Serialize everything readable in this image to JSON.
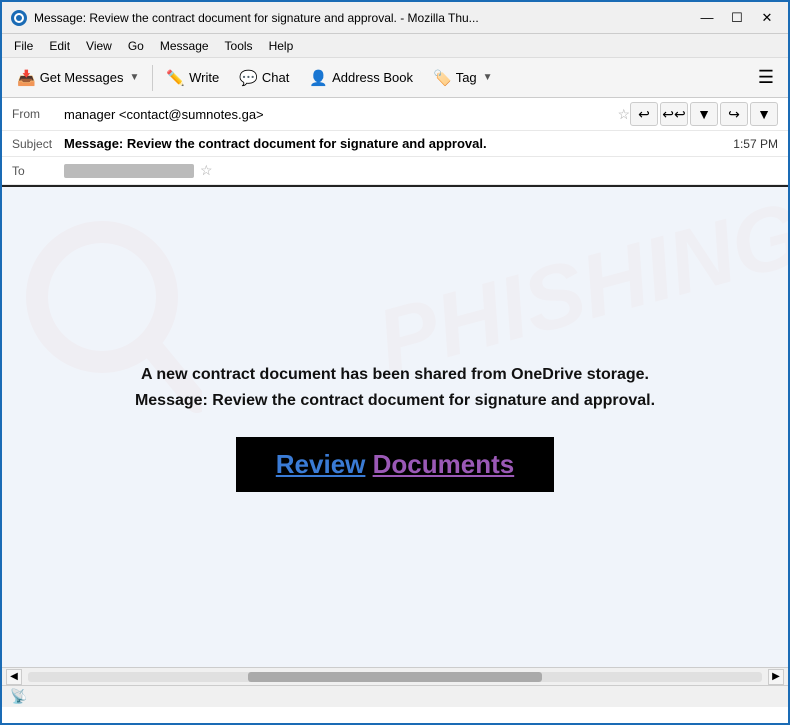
{
  "titlebar": {
    "icon": "🦣",
    "title": "Message: Review the contract document for signature and approval. - Mozilla Thu...",
    "minimize": "—",
    "maximize": "☐",
    "close": "✕"
  },
  "menubar": {
    "items": [
      "File",
      "Edit",
      "View",
      "Go",
      "Message",
      "Tools",
      "Help"
    ]
  },
  "toolbar": {
    "get_messages_label": "Get Messages",
    "write_label": "Write",
    "chat_label": "Chat",
    "address_book_label": "Address Book",
    "tag_label": "Tag"
  },
  "email": {
    "from_label": "From",
    "from_value": "manager <contact@sumnotes.ga>",
    "subject_label": "Subject",
    "subject_value": "Message: Review the contract document for signature and approval.",
    "time": "1:57 PM",
    "to_label": "To",
    "to_blurred": true
  },
  "body": {
    "main_text_line1": "A new contract document has been shared from OneDrive storage.",
    "main_text_line2": "Message: Review the contract document for signature and approval.",
    "button_word1": "Review",
    "button_word2": "Documents",
    "watermark": "PHISHING"
  },
  "statusbar": {
    "icon": "📡",
    "text": ""
  }
}
